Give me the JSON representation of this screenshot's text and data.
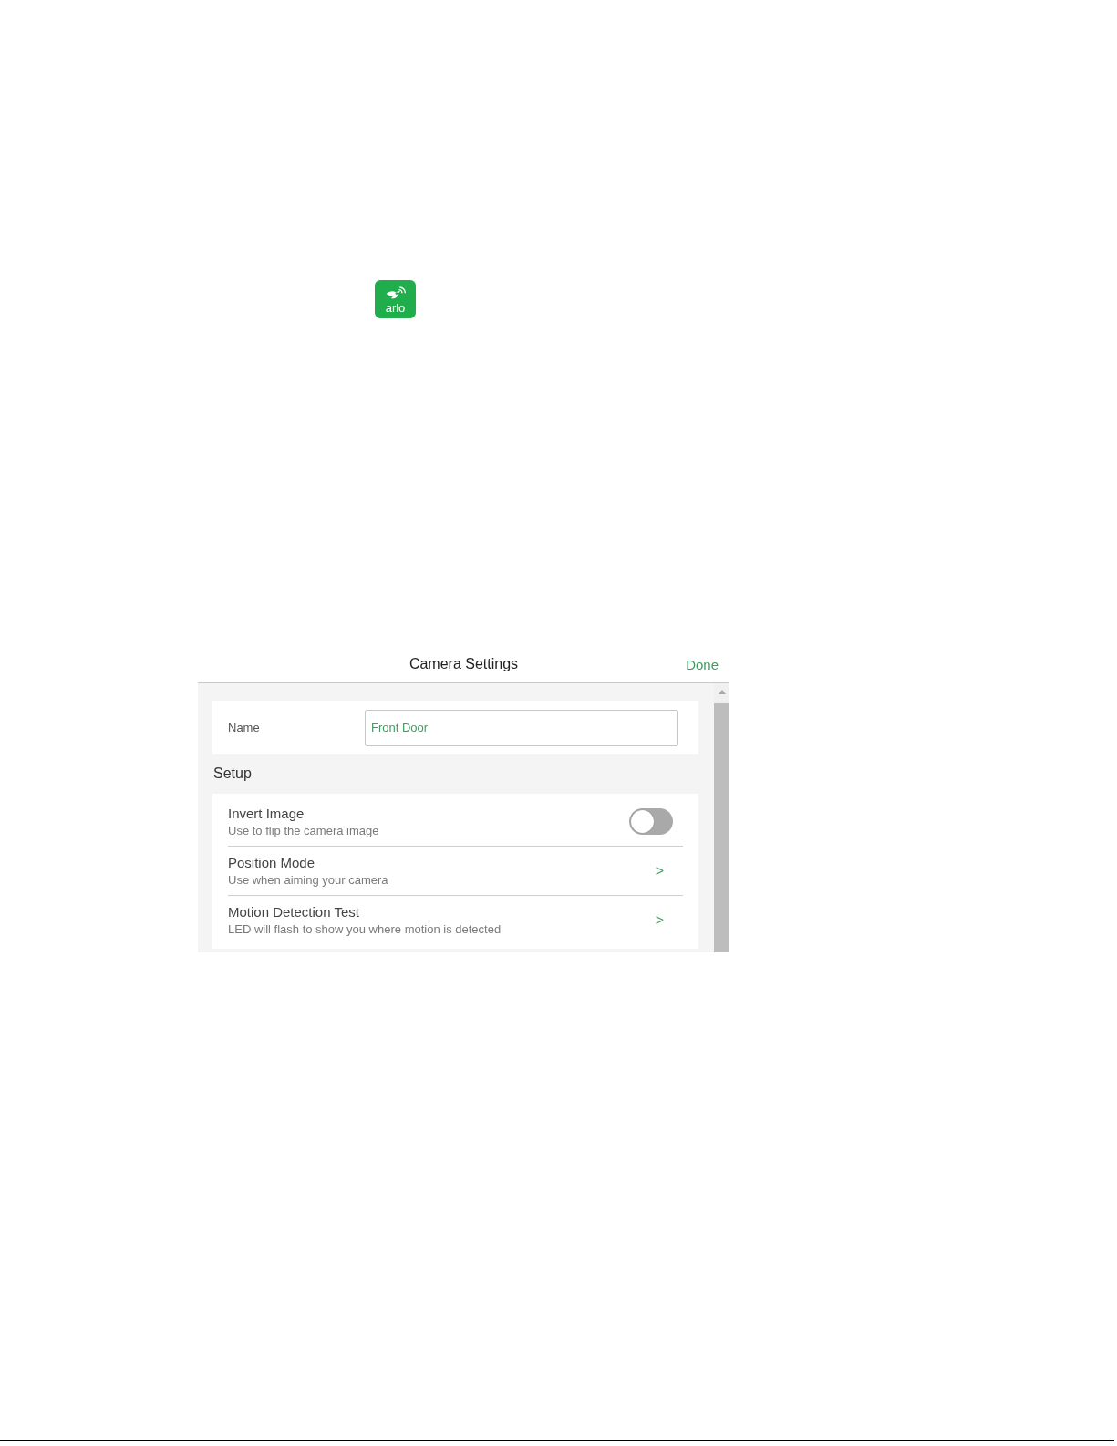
{
  "logo": {
    "text": "arlo"
  },
  "header": {
    "title": "Camera Settings",
    "done": "Done"
  },
  "name_field": {
    "label": "Name",
    "value": "Front Door"
  },
  "section": {
    "title": "Setup"
  },
  "settings": [
    {
      "kind": "toggle",
      "title": "Invert Image",
      "subtitle": "Use to flip the camera image",
      "on": false
    },
    {
      "kind": "link",
      "title": "Position Mode",
      "subtitle": "Use when aiming your camera",
      "chevron": ">"
    },
    {
      "kind": "link",
      "title": "Motion Detection Test",
      "subtitle": "LED will flash to show you where motion is detected",
      "chevron": ">"
    }
  ]
}
